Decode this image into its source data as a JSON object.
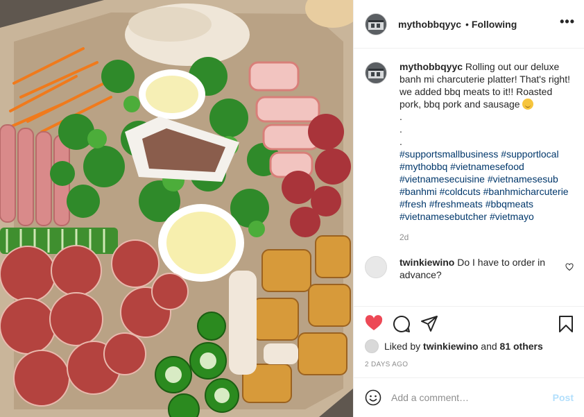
{
  "post": {
    "username": "mythobbqyyc",
    "follow_status": "Following",
    "separator": "•",
    "more_label": "•••",
    "caption": {
      "username": "mythobbqyyc",
      "text": "Rolling out our deluxe banh mi charcuterie platter! That's right! we added bbq meats to it!! Roasted pork, bbq pork and sausage",
      "dots": [
        ".",
        ".",
        "."
      ],
      "hashtags": "#supportsmallbusiness #supportlocal #mythobbq #vietnamesefood #vietnamesecuisine #vietnamesesub #banhmi #coldcuts #banhmicharcuterie #fresh #freshmeats #bbqmeats #vietnamesebutcher #vietmayo",
      "age": "2d"
    },
    "comments": [
      {
        "username": "twinkiewino",
        "text": "Do I have to order in advance?"
      }
    ],
    "likes": {
      "prefix": "Liked by",
      "user": "twinkiewino",
      "joiner": "and",
      "others": "81 others"
    },
    "date": "2 DAYS AGO",
    "add_comment": {
      "placeholder": "Add a comment…",
      "post_label": "Post"
    },
    "icons": {
      "like": "heart-filled-icon",
      "comment": "comment-bubble-icon",
      "share": "paper-plane-icon",
      "save": "bookmark-icon",
      "emoji": "smiley-icon",
      "comment_like": "heart-outline-icon"
    },
    "colors": {
      "liked": "#ed4956",
      "hashtag": "#00376b",
      "post_disabled": "#b2dffc",
      "muted": "#8e8e8e"
    }
  }
}
